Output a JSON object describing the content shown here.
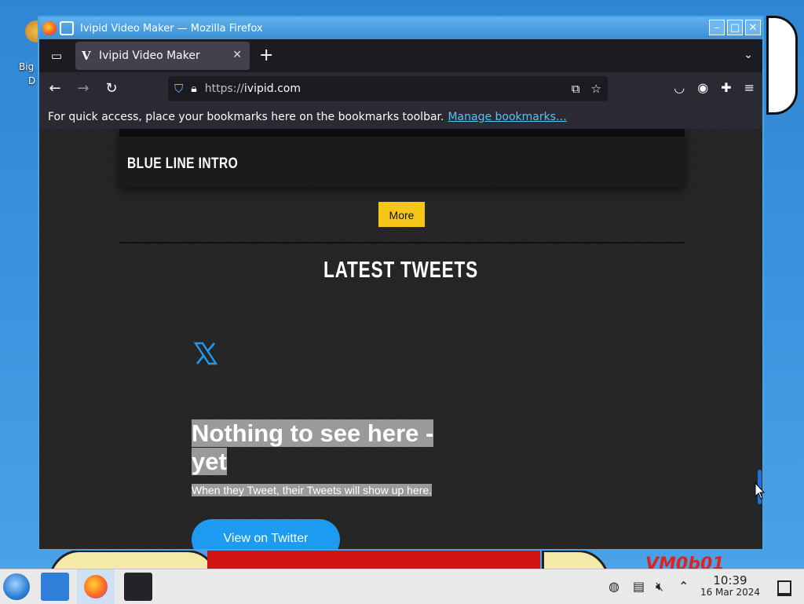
{
  "desktop": {
    "icon_label_partial_1": "Big",
    "icon_label_partial_2": "D",
    "watermark": "VM0b01"
  },
  "window": {
    "title": "Ivipid Video Maker — Mozilla Firefox",
    "controls": {
      "minimize": "–",
      "maximize": "□",
      "close": "✕"
    }
  },
  "browser": {
    "tab": {
      "favicon": "V",
      "title": "Ivipid Video Maker",
      "close": "✕"
    },
    "new_tab": "+",
    "url": {
      "protocol": "https://",
      "host": "ivipid.com"
    },
    "bookmarks_bar": {
      "message": "For quick access, place your bookmarks here on the bookmarks toolbar.",
      "link": "Manage bookmarks…"
    },
    "icons": {
      "tab_list": "tab-list-icon",
      "back": "back-arrow-icon",
      "forward": "forward-arrow-icon",
      "reload": "reload-icon",
      "shield": "tracking-shield-icon",
      "lock": "lock-icon",
      "pip": "picture-in-picture-icon",
      "bookmark_star": "star-icon",
      "pocket": "pocket-icon",
      "account": "account-icon",
      "extensions": "puzzle-icon",
      "menu": "hamburger-menu-icon"
    }
  },
  "page": {
    "card_title": "BLUE LINE INTRO",
    "more_button": "More",
    "section_title": "LATEST TWEETS",
    "twitter_empty": {
      "title": "Nothing to see here - yet",
      "subtitle": "When they Tweet, their Tweets will show up here.",
      "button": "View on Twitter"
    }
  },
  "taskbar": {
    "time": "10:39",
    "date": "16 Mar 2024"
  },
  "colors": {
    "accent_yellow": "#f5c518",
    "twitter_blue": "#1d9bf0",
    "link_blue": "#54c3f5",
    "titlebar_blue": "#3a8fd6"
  }
}
